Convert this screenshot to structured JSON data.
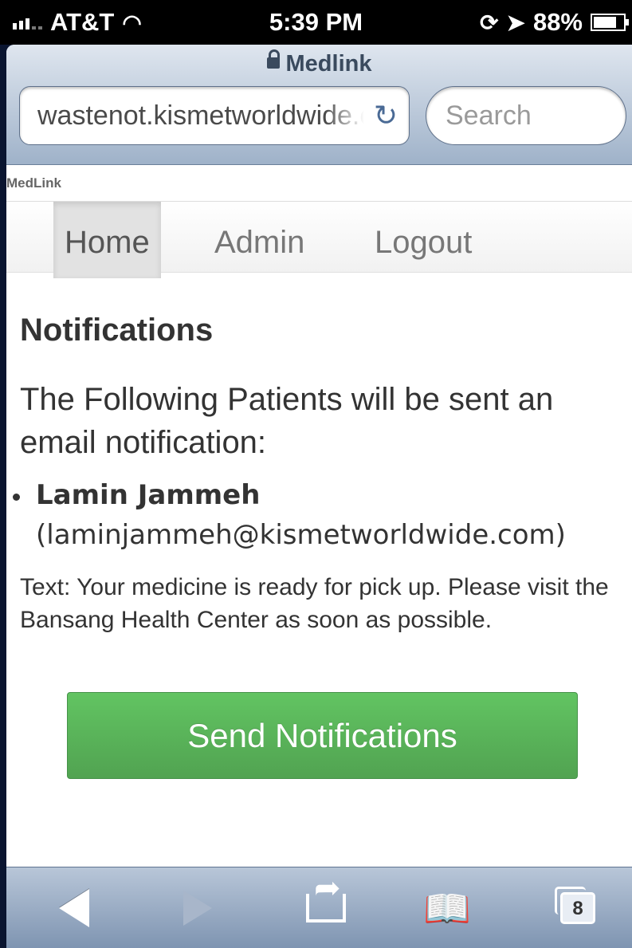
{
  "status_bar": {
    "carrier": "AT&T",
    "time": "5:39 PM",
    "battery": "88%",
    "battery_level": 0.88
  },
  "browser": {
    "page_title": "Medlink",
    "url": "wastenot.kismetworldwide.com",
    "search_placeholder": "Search",
    "tab_count": "8"
  },
  "site": {
    "label": "MedLink"
  },
  "nav": {
    "items": [
      {
        "label": "Home",
        "active": true
      },
      {
        "label": "Admin",
        "active": false
      },
      {
        "label": "Logout",
        "active": false
      }
    ]
  },
  "main": {
    "heading": "Notifications",
    "intro": "The Following Patients will be sent an email notification:",
    "patients": [
      {
        "name": "Lamin Jammeh",
        "email": "(laminjammeh@kismetworldwide.com)"
      }
    ],
    "message": "Text: Your medicine is ready for pick up. Please visit the Bansang Health Center as soon as possible.",
    "send_button": "Send Notifications"
  },
  "colors": {
    "button_green": "#5cb85c",
    "toolbar_blue": "#8fa4be"
  }
}
